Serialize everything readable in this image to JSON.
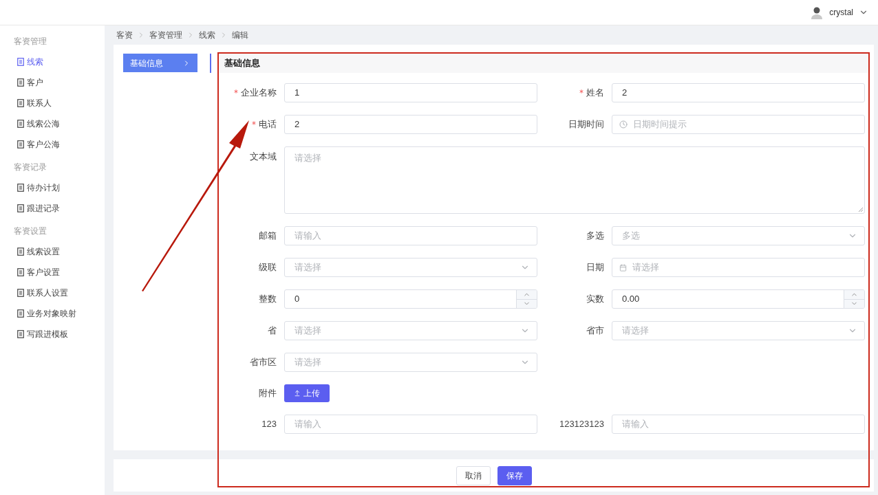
{
  "header": {
    "user": "crystal"
  },
  "sidebar": {
    "groups": [
      {
        "title": "客资管理",
        "items": [
          {
            "label": "线索",
            "selected": true
          },
          {
            "label": "客户",
            "selected": false
          },
          {
            "label": "联系人",
            "selected": false
          },
          {
            "label": "线索公海",
            "selected": false
          },
          {
            "label": "客户公海",
            "selected": false
          }
        ]
      },
      {
        "title": "客资记录",
        "items": [
          {
            "label": "待办计划",
            "selected": false
          },
          {
            "label": "跟进记录",
            "selected": false
          }
        ]
      },
      {
        "title": "客资设置",
        "items": [
          {
            "label": "线索设置",
            "selected": false
          },
          {
            "label": "客户设置",
            "selected": false
          },
          {
            "label": "联系人设置",
            "selected": false
          },
          {
            "label": "业务对象映射",
            "selected": false
          },
          {
            "label": "写跟进模板",
            "selected": false
          }
        ]
      }
    ]
  },
  "breadcrumb": [
    "客资",
    "客资管理",
    "线索",
    "编辑"
  ],
  "section_nav": [
    {
      "label": "基础信息",
      "selected": true
    }
  ],
  "form": {
    "title": "基础信息",
    "rows": [
      {
        "fields": [
          {
            "label": "企业名称",
            "kind": "text",
            "required": true,
            "value": "1"
          },
          {
            "label": "姓名",
            "kind": "text",
            "required": true,
            "value": "2"
          }
        ]
      },
      {
        "fields": [
          {
            "label": "电话",
            "kind": "text",
            "required": true,
            "value": "2"
          },
          {
            "label": "日期时间",
            "kind": "datetime",
            "required": false,
            "placeholder": "日期时间提示"
          }
        ]
      },
      {
        "fields": [
          {
            "label": "文本域",
            "kind": "textarea",
            "required": false,
            "placeholder": "请选择"
          }
        ]
      },
      {
        "fields": [
          {
            "label": "邮箱",
            "kind": "text",
            "required": false,
            "placeholder": "请输入"
          },
          {
            "label": "多选",
            "kind": "select",
            "required": false,
            "placeholder": "多选"
          }
        ]
      },
      {
        "fields": [
          {
            "label": "级联",
            "kind": "select",
            "required": false,
            "placeholder": "请选择"
          },
          {
            "label": "日期",
            "kind": "date",
            "required": false,
            "placeholder": "请选择"
          }
        ]
      },
      {
        "fields": [
          {
            "label": "整数",
            "kind": "number",
            "required": false,
            "value": "0"
          },
          {
            "label": "实数",
            "kind": "number",
            "required": false,
            "value": "0.00"
          }
        ]
      },
      {
        "fields": [
          {
            "label": "省",
            "kind": "select",
            "required": false,
            "placeholder": "请选择"
          },
          {
            "label": "省市",
            "kind": "select",
            "required": false,
            "placeholder": "请选择"
          }
        ]
      },
      {
        "fields": [
          {
            "label": "省市区",
            "kind": "select",
            "required": false,
            "placeholder": "请选择"
          }
        ]
      },
      {
        "fields": [
          {
            "label": "附件",
            "kind": "upload",
            "required": false,
            "button": "上传"
          }
        ]
      },
      {
        "fields": [
          {
            "label": "123",
            "kind": "text",
            "required": false,
            "placeholder": "请输入"
          },
          {
            "label": "123123123",
            "kind": "text",
            "required": false,
            "placeholder": "请输入"
          }
        ]
      }
    ]
  },
  "actions": [
    {
      "label": "取消",
      "kind": "secondary"
    },
    {
      "label": "保存",
      "kind": "primary"
    }
  ]
}
